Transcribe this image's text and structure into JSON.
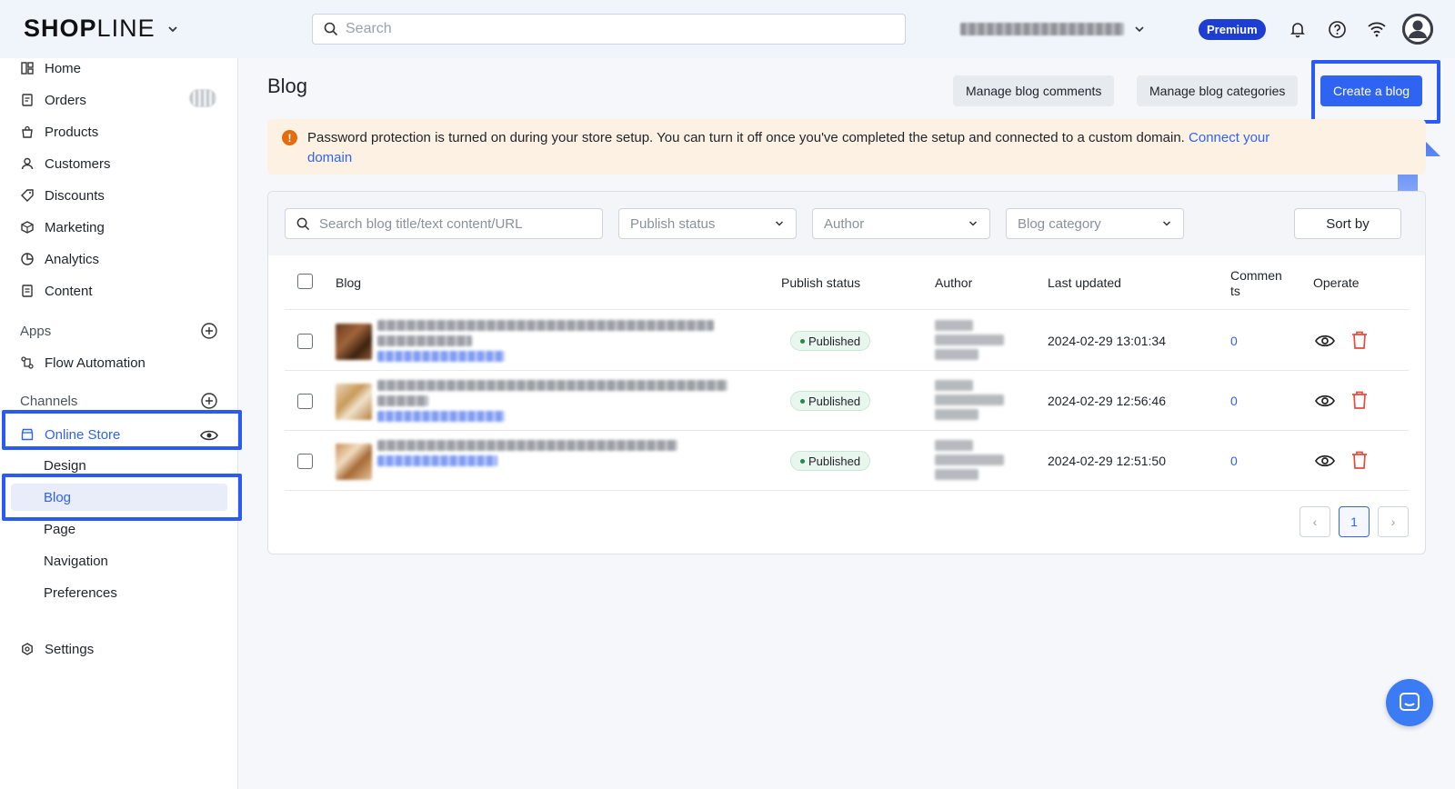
{
  "header": {
    "logo_text_a": "SH",
    "logo_text_b": "P",
    "logo_text_c": "LINE",
    "search_placeholder": "Search",
    "plan_badge": "Premium"
  },
  "sidebar": {
    "items": [
      {
        "label": "Home",
        "icon": "home-icon"
      },
      {
        "label": "Orders",
        "icon": "orders-icon"
      },
      {
        "label": "Products",
        "icon": "products-icon"
      },
      {
        "label": "Customers",
        "icon": "customers-icon"
      },
      {
        "label": "Discounts",
        "icon": "discounts-icon"
      },
      {
        "label": "Marketing",
        "icon": "marketing-icon"
      },
      {
        "label": "Analytics",
        "icon": "analytics-icon"
      },
      {
        "label": "Content",
        "icon": "content-icon"
      }
    ],
    "apps_label": "Apps",
    "flow_automation": "Flow Automation",
    "channels_label": "Channels",
    "online_store": "Online Store",
    "sub_items": [
      "Design",
      "Blog",
      "Page",
      "Navigation",
      "Preferences"
    ],
    "settings": "Settings"
  },
  "main": {
    "title": "Blog",
    "manage_comments": "Manage blog comments",
    "manage_categories": "Manage blog categories",
    "create_blog": "Create a blog",
    "alert_text": "Password protection is turned on during your store setup. You can turn it off once you've completed the setup and connected to a custom domain.",
    "alert_link_a": "Connect your",
    "alert_link_b": "domain",
    "filters": {
      "search_placeholder": "Search blog title/text content/URL",
      "publish_status": "Publish status",
      "author": "Author",
      "blog_category": "Blog category",
      "sort_by": "Sort by"
    },
    "table": {
      "headers": {
        "blog": "Blog",
        "publish_status": "Publish status",
        "author": "Author",
        "last_updated": "Last updated",
        "comments_a": "Commen",
        "comments_b": "ts",
        "operate": "Operate"
      },
      "rows": [
        {
          "status": "Published",
          "updated": "2024-02-29 13:01:34",
          "comments": "0"
        },
        {
          "status": "Published",
          "updated": "2024-02-29 12:56:46",
          "comments": "0"
        },
        {
          "status": "Published",
          "updated": "2024-02-29 12:51:50",
          "comments": "0"
        }
      ]
    },
    "pagination": {
      "current": "1",
      "prev": "‹",
      "next": "›"
    }
  },
  "colors": {
    "accent": "#2f63f2",
    "highlight": "#2a5bf6",
    "alert_bg": "#fdf1e4",
    "premium": "#1e3ed2"
  }
}
